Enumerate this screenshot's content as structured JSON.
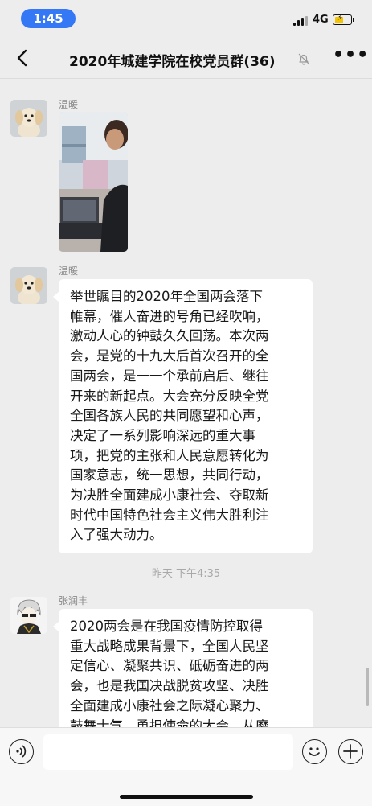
{
  "status_bar": {
    "time": "1:45",
    "network": "4G",
    "battery_level": 0.55
  },
  "nav": {
    "title": "2020年城建学院在校党员群(36)",
    "back_icon": "chevron-left-icon",
    "mute_icon": "bell-muted-icon",
    "more_icon": "more-dots-icon"
  },
  "messages": [
    {
      "type": "image",
      "sender": "温暖",
      "avatar_icon": "puppy-avatar"
    },
    {
      "type": "text",
      "sender": "温暖",
      "avatar_icon": "puppy-avatar",
      "lines": [
        "举世瞩目的2020年全国两会落下",
        "帷幕，催人奋进的号角已经吹响，",
        "激动人心的钟鼓久久回荡。本次两",
        "会，是党的十九大后首次召开的全",
        "国两会，是一一个承前启后、继往",
        "开来的新起点。大会充分反映全党",
        "全国各族人民的共同愿望和心声，",
        "决定了一系列影响深远的重大事",
        "项，把党的主张和人民意愿转化为",
        "国家意志，统一思想，共同行动，",
        "为决胜全面建成小康社会、夺取新",
        "时代中国特色社会主义伟大胜利注",
        "入了强大动力。"
      ]
    },
    {
      "type": "timestamp",
      "text": "昨天 下午4:35"
    },
    {
      "type": "text",
      "sender": "张润丰",
      "avatar_icon": "cartoon-avatar",
      "lines": [
        "2020两会是在我国疫情防控取得",
        "重大战略成果背景下，全国人民坚",
        "定信心、凝聚共识、砥砺奋进的两",
        "会，也是我国决战脱贫攻坚、决胜",
        "全面建成小康社会之际凝心聚力、",
        "鼓舞士气、勇担使命的大会。从磨"
      ]
    }
  ],
  "input_bar": {
    "voice_icon": "voice-icon",
    "emoji_icon": "emoji-icon",
    "plus_icon": "plus-icon",
    "input_value": ""
  }
}
